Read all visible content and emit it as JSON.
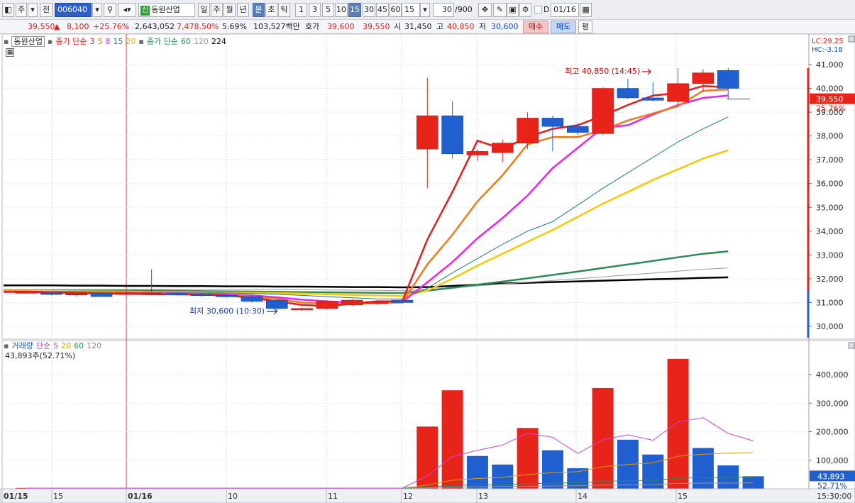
{
  "toolbar": {
    "type_label": "주",
    "prev_label": "전",
    "code": "006040",
    "new_tag": "신",
    "stock_name": "동원산업",
    "periods": [
      "일",
      "주",
      "월",
      "년",
      "분",
      "초",
      "틱"
    ],
    "minutes": [
      "1",
      "3",
      "5",
      "10",
      "15",
      "30",
      "45",
      "60"
    ],
    "interval_value": "15",
    "count_value": "30",
    "count_max": "/900",
    "date_value": "01/16",
    "checkbox_label": "D"
  },
  "info": {
    "price": "39,550",
    "change_arrow": "▲",
    "change": "8,100",
    "change_pct": "+25.76%",
    "volume": "2,643,052",
    "volume_pct": "7,478.50%",
    "turnover_pct": "5.69%",
    "amount": "103,527백만",
    "bid_label": "호가",
    "bid_price": "39,600",
    "ask_price": "39,550",
    "open_label": "시",
    "open": "31,450",
    "high_label": "고",
    "high": "40,850",
    "low_label": "저",
    "low": "30,600",
    "buy_button": "매수",
    "sell_button": "매도",
    "eval_button": "평"
  },
  "price_panel": {
    "name_label": "동원산업",
    "ma_title_1": "종가 단순",
    "ma_periods_1": [
      "3",
      "5",
      "8",
      "15",
      "20"
    ],
    "ma_title_2": "종가 단순",
    "ma_periods_2": [
      "60",
      "120",
      "224"
    ],
    "lc_label": "LC:29.25",
    "hc_label": "HC:-3.18",
    "high_annotation": "최고 40,850 (14:45)",
    "low_annotation": "최저 30,600 (10:30)",
    "current_price_tag": "39,550",
    "current_pct_tag": "25.76%"
  },
  "volume_panel": {
    "title": "거래량",
    "ma_title": "단순",
    "ma_periods": [
      "5",
      "20",
      "60",
      "120"
    ],
    "current_value": "43,893주(52.71%)",
    "current_tag": "43,893",
    "current_pct_tag": "52.71%"
  },
  "x_axis": {
    "labels": [
      "01/15",
      "15",
      "01/16",
      "10",
      "11",
      "12",
      "13",
      "14",
      "15",
      "15:30:00"
    ]
  },
  "colors": {
    "up": "#e8231a",
    "down": "#1f5fcf",
    "ma3": "#e81a1a",
    "ma5": "#f07a1a",
    "ma8": "#f020f0",
    "ma15": "#1a7a8a",
    "ma20": "#f5c800",
    "ma60": "#2e8b57",
    "ma120": "#999999",
    "ma224": "#000000"
  },
  "chart_data": [
    {
      "type": "candlestick",
      "title": "동원산업",
      "ylim": [
        29700,
        41300
      ],
      "y_ticks": [
        30000,
        31000,
        32000,
        33000,
        34000,
        35000,
        36000,
        37000,
        38000,
        39000,
        40000,
        41000
      ],
      "y_tick_labels": [
        "30,000",
        "31,000",
        "32,000",
        "33,000",
        "34,000",
        "35,000",
        "36,000",
        "37,000",
        "38,000",
        "39,000",
        "40,000",
        "41,000"
      ],
      "candles": [
        {
          "i": 0,
          "o": 31450,
          "h": 31500,
          "l": 31400,
          "c": 31450
        },
        {
          "i": 1,
          "o": 31400,
          "h": 31450,
          "l": 31300,
          "c": 31350
        },
        {
          "i": 2,
          "o": 31350,
          "h": 31400,
          "l": 31250,
          "c": 31380
        },
        {
          "i": 3,
          "o": 31400,
          "h": 31450,
          "l": 31250,
          "c": 31250
        },
        {
          "i": 4,
          "o": 31350,
          "h": 31500,
          "l": 31300,
          "c": 31400
        },
        {
          "i": 5,
          "o": 31350,
          "h": 32400,
          "l": 31300,
          "c": 31400
        },
        {
          "i": 6,
          "o": 31380,
          "h": 31420,
          "l": 31300,
          "c": 31350
        },
        {
          "i": 7,
          "o": 31350,
          "h": 31400,
          "l": 31250,
          "c": 31300
        },
        {
          "i": 8,
          "o": 31300,
          "h": 31350,
          "l": 31200,
          "c": 31250
        },
        {
          "i": 9,
          "o": 31250,
          "h": 31300,
          "l": 31000,
          "c": 31050
        },
        {
          "i": 10,
          "o": 31100,
          "h": 31150,
          "l": 30600,
          "c": 30750
        },
        {
          "i": 11,
          "o": 30750,
          "h": 30800,
          "l": 30650,
          "c": 30750
        },
        {
          "i": 12,
          "o": 30750,
          "h": 31100,
          "l": 30700,
          "c": 31050
        },
        {
          "i": 13,
          "o": 30900,
          "h": 31150,
          "l": 30850,
          "c": 31100
        },
        {
          "i": 14,
          "o": 30950,
          "h": 31100,
          "l": 30900,
          "c": 31050
        },
        {
          "i": 15,
          "o": 31100,
          "h": 31150,
          "l": 30950,
          "c": 31000
        },
        {
          "i": 16,
          "o": 37450,
          "h": 40450,
          "l": 35800,
          "c": 38850
        },
        {
          "i": 17,
          "o": 38850,
          "h": 39450,
          "l": 37050,
          "c": 37250
        },
        {
          "i": 18,
          "o": 37200,
          "h": 37450,
          "l": 36950,
          "c": 37350
        },
        {
          "i": 19,
          "o": 37300,
          "h": 37850,
          "l": 36900,
          "c": 37700
        },
        {
          "i": 20,
          "o": 37700,
          "h": 39000,
          "l": 37450,
          "c": 38750
        },
        {
          "i": 21,
          "o": 38750,
          "h": 38850,
          "l": 37350,
          "c": 38400
        },
        {
          "i": 22,
          "o": 38400,
          "h": 38550,
          "l": 38050,
          "c": 38150
        },
        {
          "i": 23,
          "o": 38100,
          "h": 40050,
          "l": 38050,
          "c": 40000
        },
        {
          "i": 24,
          "o": 40000,
          "h": 40400,
          "l": 39550,
          "c": 39600
        },
        {
          "i": 25,
          "o": 39600,
          "h": 40250,
          "l": 39450,
          "c": 39500
        },
        {
          "i": 26,
          "o": 39450,
          "h": 40850,
          "l": 39300,
          "c": 40200
        },
        {
          "i": 27,
          "o": 40200,
          "h": 40800,
          "l": 39850,
          "c": 40650
        },
        {
          "i": 28,
          "o": 40750,
          "h": 40850,
          "l": 39550,
          "c": 40000
        }
      ],
      "ma_lines": {
        "ma3": [
          31450,
          31420,
          31400,
          31380,
          31370,
          31350,
          31340,
          31330,
          31300,
          31200,
          31050,
          30900,
          30850,
          30950,
          31050,
          31050,
          33650,
          35650,
          37800,
          37450,
          37950,
          38300,
          38450,
          38850,
          39300,
          39700,
          39800,
          40100,
          40050
        ],
        "ma5": [
          31450,
          31430,
          31410,
          31400,
          31380,
          31370,
          31350,
          31340,
          31310,
          31250,
          31150,
          31000,
          30950,
          30950,
          30980,
          31000,
          32600,
          33850,
          35250,
          36350,
          37650,
          37950,
          37950,
          38250,
          38650,
          38950,
          39250,
          39900,
          39950
        ],
        "ma8": [
          31460,
          31440,
          31420,
          31410,
          31400,
          31390,
          31380,
          31370,
          31340,
          31300,
          31220,
          31120,
          31050,
          31000,
          31000,
          31020,
          31850,
          32700,
          33700,
          34550,
          35500,
          36650,
          37500,
          38350,
          38450,
          38900,
          39300,
          39600,
          39700
        ],
        "ma15": [
          31480,
          31470,
          31460,
          31450,
          31440,
          31430,
          31420,
          31410,
          31400,
          31380,
          31350,
          31300,
          31250,
          31200,
          31150,
          31150,
          31600,
          32250,
          32850,
          33450,
          34000,
          34400,
          35100,
          35800,
          36450,
          37100,
          37750,
          38300,
          38800
        ],
        "ma20": [
          31500,
          31490,
          31480,
          31470,
          31460,
          31450,
          31440,
          31430,
          31420,
          31410,
          31400,
          31380,
          31350,
          31320,
          31300,
          31280,
          31500,
          32000,
          32550,
          33050,
          33550,
          34050,
          34600,
          35150,
          35650,
          36150,
          36600,
          37050,
          37400
        ],
        "ma60": [
          31500,
          31500,
          31500,
          31500,
          31500,
          31500,
          31490,
          31480,
          31470,
          31460,
          31450,
          31440,
          31430,
          31420,
          31410,
          31400,
          31500,
          31620,
          31750,
          31880,
          32020,
          32160,
          32300,
          32450,
          32600,
          32750,
          32900,
          33050,
          33150
        ],
        "ma120": [
          31550,
          31550,
          31550,
          31550,
          31550,
          31550,
          31550,
          31550,
          31550,
          31550,
          31550,
          31540,
          31530,
          31520,
          31510,
          31500,
          31550,
          31620,
          31700,
          31780,
          31850,
          31930,
          32000,
          32080,
          32160,
          32240,
          32320,
          32400,
          32450
        ],
        "ma224": [
          31720,
          31720,
          31710,
          31710,
          31700,
          31700,
          31690,
          31690,
          31680,
          31680,
          31670,
          31670,
          31660,
          31650,
          31650,
          31640,
          31650,
          31700,
          31750,
          31800,
          31830,
          31860,
          31890,
          31920,
          31950,
          31980,
          32000,
          32040,
          32060
        ]
      }
    },
    {
      "type": "bar",
      "title": "거래량",
      "ylim": [
        0,
        490000
      ],
      "y_ticks": [
        100000,
        200000,
        300000,
        400000
      ],
      "y_tick_labels": [
        "100,000",
        "200,000",
        "300,000",
        "400,000"
      ],
      "bars": [
        {
          "i": 0,
          "v": 3000,
          "up": true
        },
        {
          "i": 1,
          "v": 2000,
          "up": false
        },
        {
          "i": 2,
          "v": 2000,
          "up": true
        },
        {
          "i": 3,
          "v": 2000,
          "up": false
        },
        {
          "i": 4,
          "v": 2000,
          "up": true
        },
        {
          "i": 5,
          "v": 3000,
          "up": true
        },
        {
          "i": 6,
          "v": 2000,
          "up": false
        },
        {
          "i": 7,
          "v": 2000,
          "up": false
        },
        {
          "i": 8,
          "v": 2000,
          "up": false
        },
        {
          "i": 9,
          "v": 2000,
          "up": false
        },
        {
          "i": 10,
          "v": 2000,
          "up": false
        },
        {
          "i": 11,
          "v": 2000,
          "up": true
        },
        {
          "i": 12,
          "v": 2000,
          "up": true
        },
        {
          "i": 13,
          "v": 2000,
          "up": true
        },
        {
          "i": 14,
          "v": 2000,
          "up": true
        },
        {
          "i": 15,
          "v": 2000,
          "up": false
        },
        {
          "i": 16,
          "v": 218000,
          "up": true
        },
        {
          "i": 17,
          "v": 345000,
          "up": true
        },
        {
          "i": 18,
          "v": 115000,
          "up": false
        },
        {
          "i": 19,
          "v": 85000,
          "up": false
        },
        {
          "i": 20,
          "v": 213000,
          "up": true
        },
        {
          "i": 21,
          "v": 135000,
          "up": false
        },
        {
          "i": 22,
          "v": 72000,
          "up": false
        },
        {
          "i": 23,
          "v": 353000,
          "up": true
        },
        {
          "i": 24,
          "v": 172000,
          "up": false
        },
        {
          "i": 25,
          "v": 120000,
          "up": false
        },
        {
          "i": 26,
          "v": 455000,
          "up": true
        },
        {
          "i": 27,
          "v": 143000,
          "up": false
        },
        {
          "i": 28,
          "v": 82000,
          "up": false
        },
        {
          "i": 29,
          "v": 43893,
          "up": false
        }
      ],
      "ma_lines": {
        "ma5": [
          2500,
          2400,
          2300,
          2200,
          2200,
          2200,
          2200,
          2200,
          2200,
          2200,
          2200,
          2200,
          2200,
          2200,
          2200,
          2200,
          45000,
          113000,
          135000,
          153000,
          195000,
          180000,
          124000,
          172000,
          189000,
          170000,
          234000,
          249000,
          194000,
          168000
        ],
        "ma20": [
          2500,
          2500,
          2500,
          2500,
          2500,
          2500,
          2500,
          2500,
          2500,
          2500,
          2500,
          2500,
          2500,
          2500,
          2500,
          2500,
          13000,
          30000,
          36000,
          40000,
          50000,
          57000,
          60000,
          77000,
          85000,
          91000,
          114000,
          121000,
          125000,
          127000
        ],
        "ma60": [
          2000,
          2000,
          2000,
          2000,
          2000,
          2000,
          2000,
          2000,
          2000,
          2000,
          2000,
          2000,
          2000,
          2000,
          2000,
          2000,
          6000,
          12000,
          14000,
          15000,
          18000,
          20000,
          21000,
          26000,
          28000,
          30000,
          37000,
          39000,
          40000,
          41000
        ],
        "ma120": [
          1500,
          1500,
          1500,
          1500,
          1500,
          1500,
          1500,
          1500,
          1500,
          1500,
          1500,
          1500,
          1500,
          1500,
          1500,
          1500,
          3000,
          6000,
          7000,
          8000,
          9000,
          10000,
          11000,
          13000,
          14000,
          15000,
          19000,
          20000,
          20000,
          21000
        ]
      }
    }
  ]
}
